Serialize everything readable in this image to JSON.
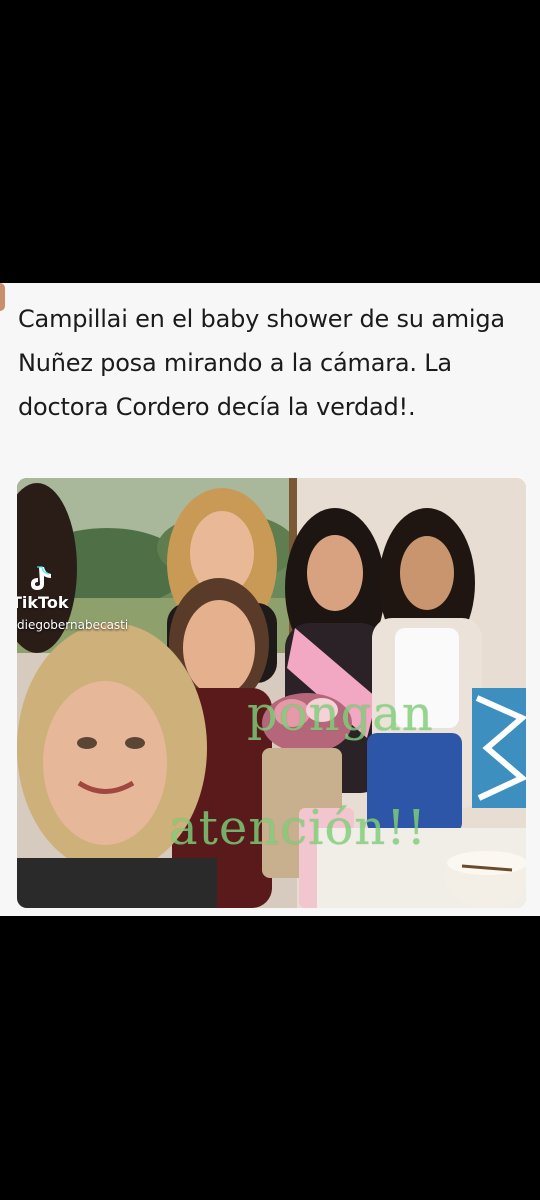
{
  "post": {
    "caption": "Campillai en el baby shower de su amiga Nuñez posa mirando a la cámara. La doctora Cordero decía la verdad!."
  },
  "video_watermark": {
    "brand": "TikTok",
    "username": "diegobernabecasti",
    "icon": "tiktok-logo-icon"
  },
  "overlay_text": {
    "line1": "pongan",
    "line2": "atención!!",
    "color": "#7fcf78"
  }
}
